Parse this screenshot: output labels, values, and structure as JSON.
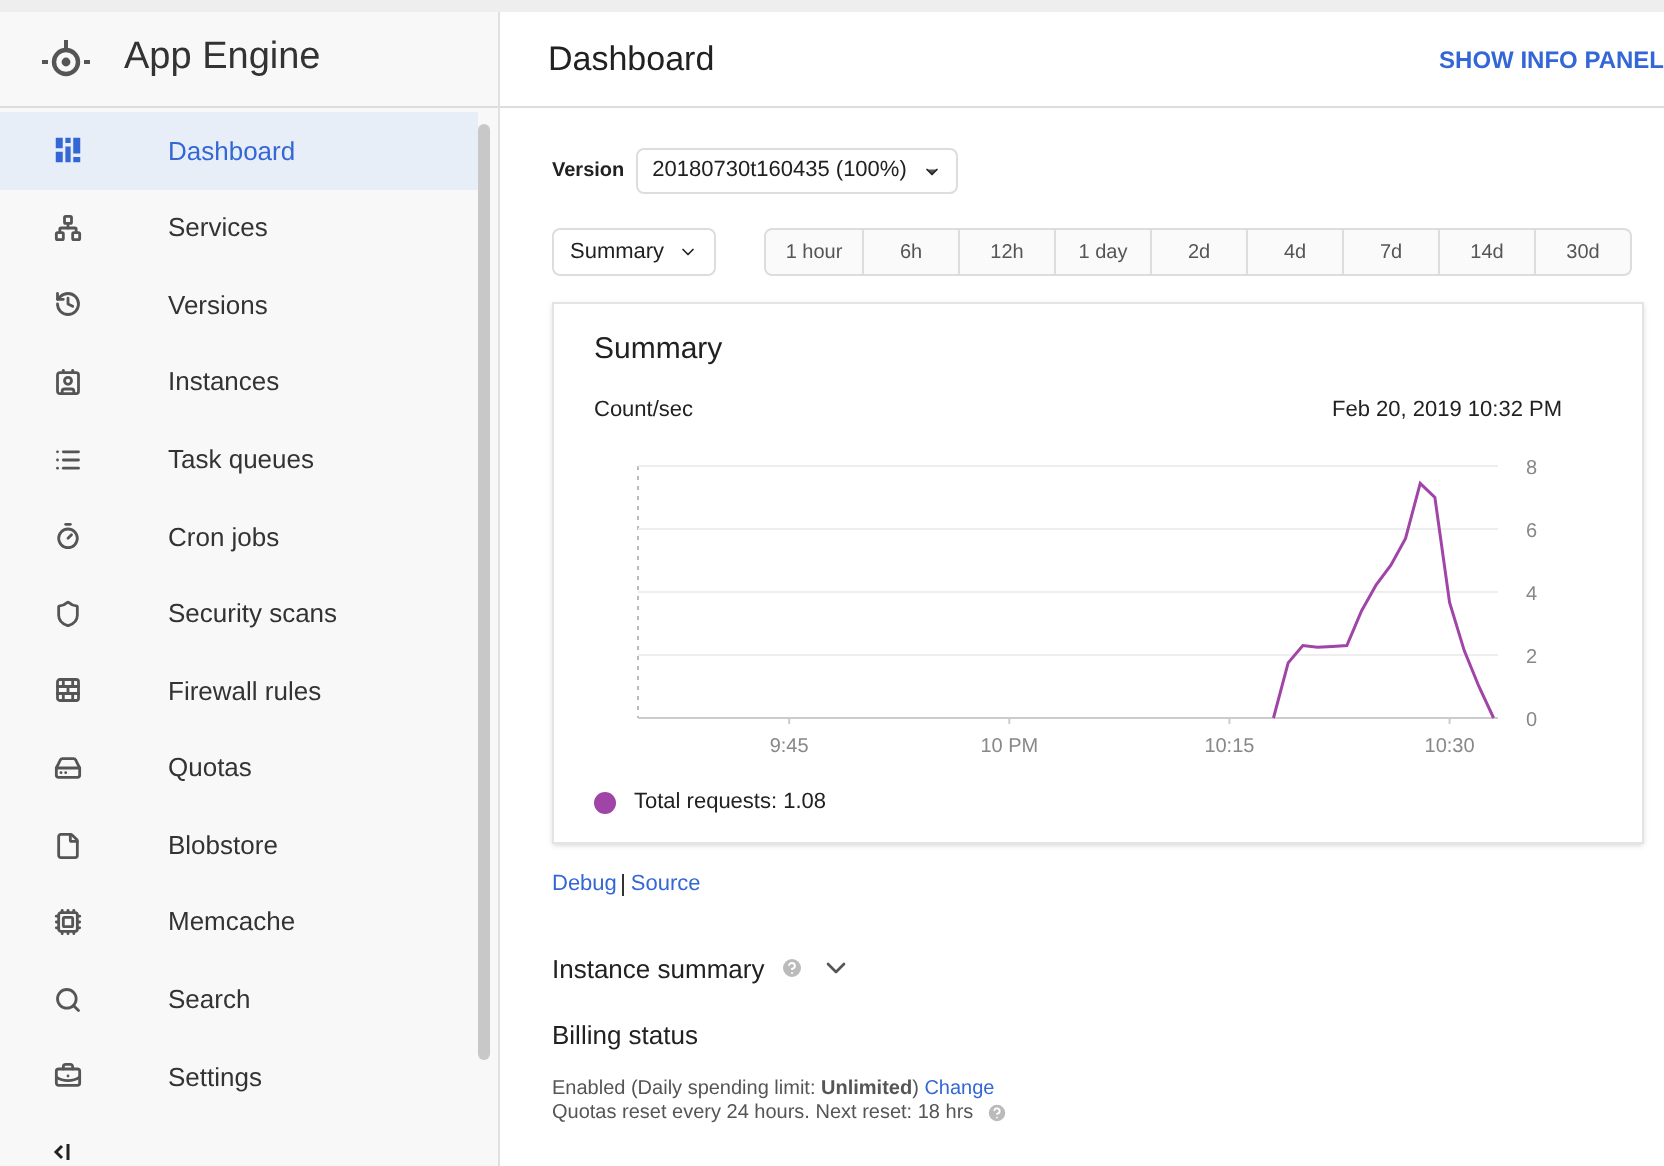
{
  "product": {
    "title": "App Engine"
  },
  "sidebar": {
    "items": [
      {
        "label": "Dashboard",
        "selected": true
      },
      {
        "label": "Services",
        "selected": false
      },
      {
        "label": "Versions",
        "selected": false
      },
      {
        "label": "Instances",
        "selected": false
      },
      {
        "label": "Task queues",
        "selected": false
      },
      {
        "label": "Cron jobs",
        "selected": false
      },
      {
        "label": "Security scans",
        "selected": false
      },
      {
        "label": "Firewall rules",
        "selected": false
      },
      {
        "label": "Quotas",
        "selected": false
      },
      {
        "label": "Blobstore",
        "selected": false
      },
      {
        "label": "Memcache",
        "selected": false
      },
      {
        "label": "Search",
        "selected": false
      },
      {
        "label": "Settings",
        "selected": false
      }
    ]
  },
  "header": {
    "title": "Dashboard",
    "action": "SHOW INFO PANEL"
  },
  "version": {
    "label": "Version",
    "value": "20180730t160435 (100%)"
  },
  "view_select": {
    "value": "Summary"
  },
  "ranges": [
    {
      "label": "1 hour"
    },
    {
      "label": "6h"
    },
    {
      "label": "12h"
    },
    {
      "label": "1 day"
    },
    {
      "label": "2d"
    },
    {
      "label": "4d"
    },
    {
      "label": "7d"
    },
    {
      "label": "14d"
    },
    {
      "label": "30d"
    }
  ],
  "card": {
    "timestamp": "Feb 20, 2019 10:32 PM",
    "chart_data": {
      "type": "line",
      "title": "Summary",
      "ylabel": "Count/sec",
      "categories": [
        null,
        null,
        null,
        null,
        null,
        null,
        null,
        null,
        null,
        null,
        "9:45",
        null,
        null,
        null,
        null,
        null,
        null,
        null,
        null,
        null,
        null,
        null,
        null,
        null,
        null,
        "10 PM",
        null,
        null,
        null,
        null,
        null,
        null,
        null,
        null,
        null,
        null,
        null,
        null,
        null,
        null,
        "10:15",
        null,
        null,
        null,
        null,
        null,
        null,
        null,
        null,
        null,
        null,
        null,
        null,
        null,
        null,
        "10:30",
        null,
        null,
        null
      ],
      "series": [
        {
          "name": "Total requests: 1.08",
          "color": "#a044a8",
          "values": [
            null,
            null,
            null,
            null,
            null,
            null,
            null,
            null,
            null,
            null,
            null,
            null,
            null,
            null,
            null,
            null,
            null,
            null,
            null,
            null,
            null,
            null,
            null,
            null,
            null,
            null,
            null,
            null,
            null,
            null,
            null,
            null,
            null,
            null,
            null,
            null,
            null,
            null,
            null,
            null,
            null,
            null,
            null,
            0,
            1.75,
            2.3,
            2.25,
            2.27,
            2.3,
            3.4,
            4.23,
            4.85,
            5.7,
            7.45,
            7.0,
            3.67,
            2.14,
            1.0,
            0
          ]
        }
      ],
      "grid": true,
      "ylim": [
        0,
        8
      ],
      "yticks": [
        0,
        2,
        4,
        6,
        8
      ]
    }
  },
  "links": [
    "Debug",
    "Source"
  ],
  "instance_summary": {
    "title": "Instance summary",
    "expanded": false
  },
  "billing": {
    "title": "Billing status",
    "line_1": "Enabled (Daily spending limit: **Unlimited**)",
    "change_link": "Change",
    "line_2": "Quotas reset every 24 hours. Next reset: 18 hrs"
  }
}
